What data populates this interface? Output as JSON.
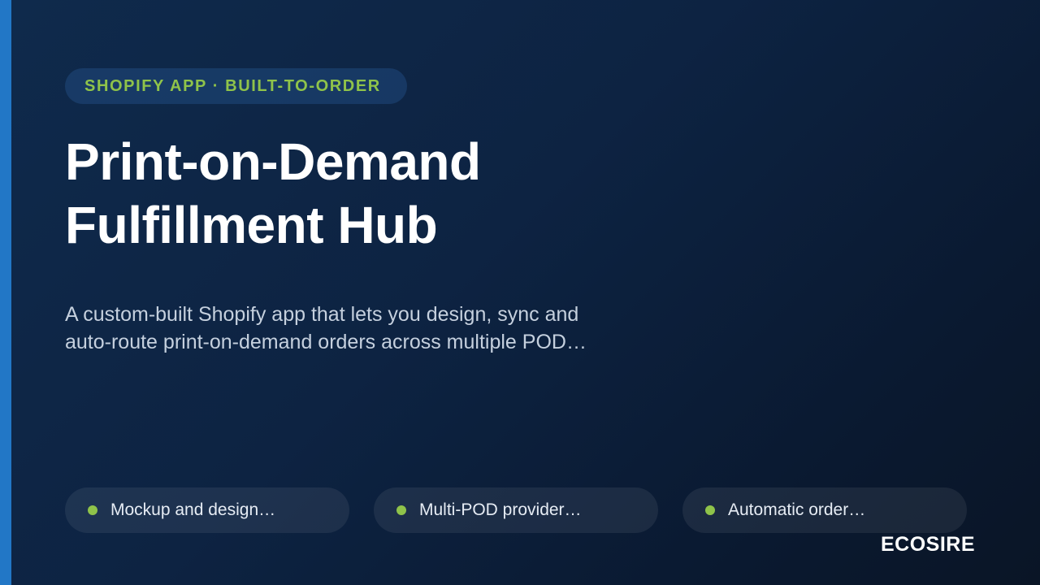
{
  "eyebrow": "SHOPIFY APP · BUILT-TO-ORDER",
  "title": {
    "line1": "Print-on-Demand",
    "line2": "Fulfillment Hub"
  },
  "description": {
    "line1": "A custom-built Shopify app that lets you design, sync and",
    "line2": "auto-route print-on-demand orders across multiple POD…"
  },
  "features": [
    {
      "label": "Mockup and design…"
    },
    {
      "label": "Multi-POD provider…"
    },
    {
      "label": "Automatic order…"
    }
  ],
  "brand": "ECOSIRE",
  "colors": {
    "accent_bar": "#2277c6",
    "eyebrow_text": "#8fc34a",
    "bullet_dot": "#8fc34a",
    "background": "#0d2342"
  }
}
